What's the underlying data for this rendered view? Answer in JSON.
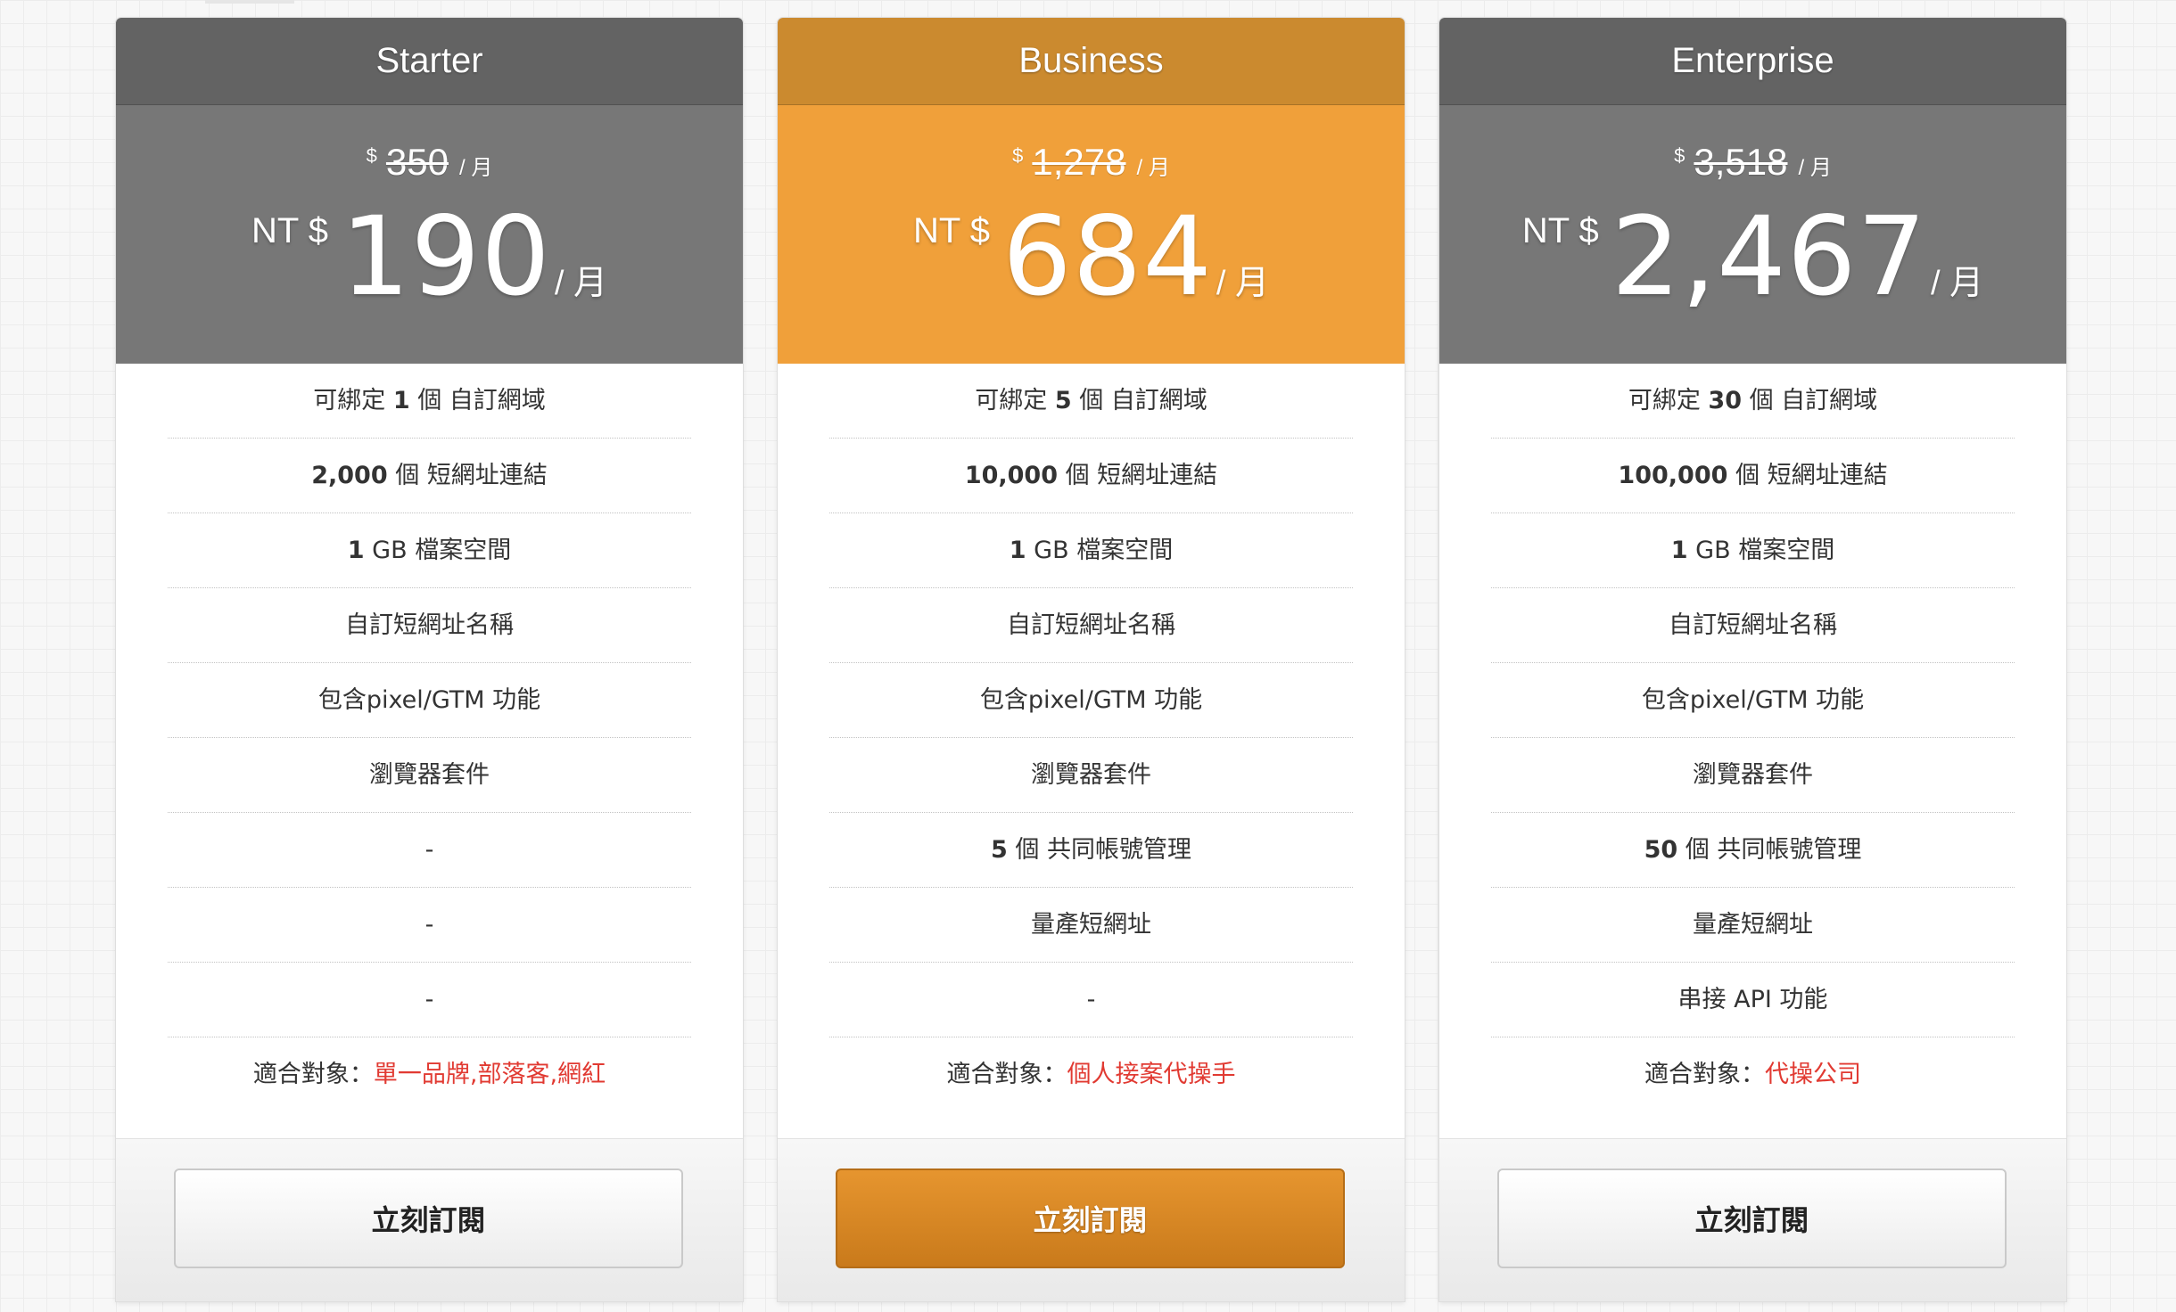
{
  "colors": {
    "gray_header": "#636363",
    "gray_price": "#777777",
    "orange_header": "#cb8a2f",
    "orange_price": "#f0a03a",
    "highlight_text": "#e13a32"
  },
  "plans": [
    {
      "name": "Starter",
      "theme": "gray",
      "old_currency": "$",
      "old_price": "350",
      "old_unit": "/ 月",
      "currency": "NT $",
      "price": "190",
      "unit": "/ 月",
      "features": [
        {
          "pre": "可綁定 ",
          "bold": "1",
          "post": " 個 自訂網域"
        },
        {
          "pre": "",
          "bold": "2,000",
          "post": " 個 短網址連結"
        },
        {
          "pre": "",
          "bold": "1",
          "post": " GB 檔案空間"
        },
        {
          "pre": "自訂短網址名稱",
          "bold": "",
          "post": ""
        },
        {
          "pre": "包含pixel/GTM 功能",
          "bold": "",
          "post": ""
        },
        {
          "pre": "瀏覽器套件",
          "bold": "",
          "post": ""
        },
        {
          "pre": "-",
          "bold": "",
          "post": ""
        },
        {
          "pre": "-",
          "bold": "",
          "post": ""
        },
        {
          "pre": "-",
          "bold": "",
          "post": ""
        }
      ],
      "fit_label": "適合對象：",
      "fit_value": "單一品牌,部落客,網紅",
      "button_label": "立刻訂閱",
      "button_style": "light"
    },
    {
      "name": "Business",
      "theme": "orange",
      "old_currency": "$",
      "old_price": "1,278",
      "old_unit": "/ 月",
      "currency": "NT $",
      "price": "684",
      "unit": "/ 月",
      "features": [
        {
          "pre": "可綁定 ",
          "bold": "5",
          "post": " 個 自訂網域"
        },
        {
          "pre": "",
          "bold": "10,000",
          "post": " 個 短網址連結"
        },
        {
          "pre": "",
          "bold": "1",
          "post": " GB 檔案空間"
        },
        {
          "pre": "自訂短網址名稱",
          "bold": "",
          "post": ""
        },
        {
          "pre": "包含pixel/GTM 功能",
          "bold": "",
          "post": ""
        },
        {
          "pre": "瀏覽器套件",
          "bold": "",
          "post": ""
        },
        {
          "pre": "",
          "bold": "5",
          "post": " 個 共同帳號管理"
        },
        {
          "pre": "量產短網址",
          "bold": "",
          "post": ""
        },
        {
          "pre": "-",
          "bold": "",
          "post": ""
        }
      ],
      "fit_label": "適合對象：",
      "fit_value": "個人接案代操手",
      "button_label": "立刻訂閱",
      "button_style": "dark"
    },
    {
      "name": "Enterprise",
      "theme": "gray",
      "old_currency": "$",
      "old_price": "3,518",
      "old_unit": "/ 月",
      "currency": "NT $",
      "price": "2,467",
      "unit": "/ 月",
      "features": [
        {
          "pre": "可綁定 ",
          "bold": "30",
          "post": " 個 自訂網域"
        },
        {
          "pre": "",
          "bold": "100,000",
          "post": " 個 短網址連結"
        },
        {
          "pre": "",
          "bold": "1",
          "post": " GB 檔案空間"
        },
        {
          "pre": "自訂短網址名稱",
          "bold": "",
          "post": ""
        },
        {
          "pre": "包含pixel/GTM 功能",
          "bold": "",
          "post": ""
        },
        {
          "pre": "瀏覽器套件",
          "bold": "",
          "post": ""
        },
        {
          "pre": "",
          "bold": "50",
          "post": " 個 共同帳號管理"
        },
        {
          "pre": "量產短網址",
          "bold": "",
          "post": ""
        },
        {
          "pre": "串接 API 功能",
          "bold": "",
          "post": ""
        }
      ],
      "fit_label": "適合對象：",
      "fit_value": "代操公司",
      "button_label": "立刻訂閱",
      "button_style": "light"
    }
  ]
}
